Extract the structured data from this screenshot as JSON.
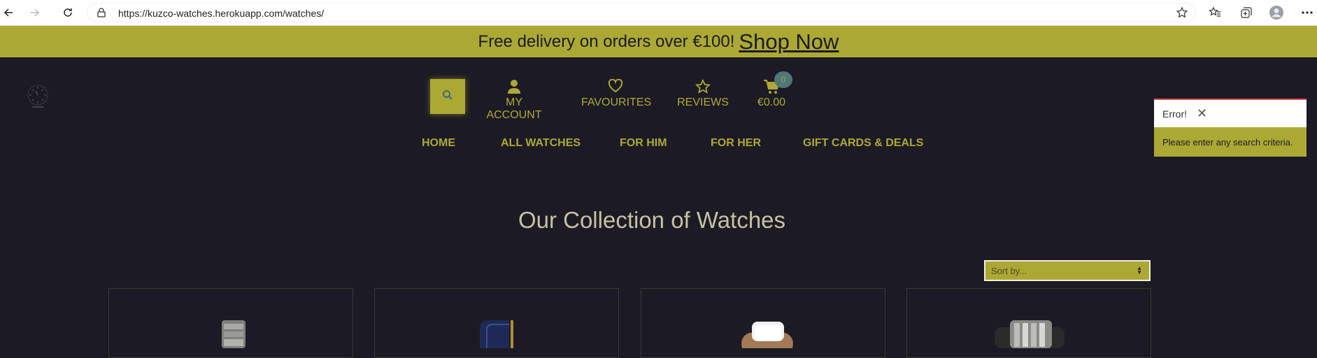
{
  "browser": {
    "url": "https://kuzco-watches.herokuapp.com/watches/",
    "icons": [
      "back-icon",
      "forward-icon",
      "reload-icon",
      "lock-icon",
      "favorite-add-icon",
      "favorites-icon",
      "collections-icon",
      "profile-icon",
      "more-icon"
    ]
  },
  "banner": {
    "text": "Free delivery on orders over €100!",
    "link": "Shop Now"
  },
  "header": {
    "my_account": "MY ACCOUNT",
    "favourites": "FAVOURITES",
    "reviews": "REVIEWS",
    "cart_total": "€0.00",
    "cart_count": "0"
  },
  "nav": {
    "home": "HOME",
    "all_watches": "ALL WATCHES",
    "for_him": "FOR HIM",
    "for_her": "FOR HER",
    "gift_cards": "GIFT CARDS & DEALS"
  },
  "toast": {
    "title": "Error!",
    "message": "Please enter any search criteria."
  },
  "main": {
    "heading": "Our Collection of Watches",
    "sort_placeholder": "Sort by..."
  },
  "colors": {
    "accent": "#aba934",
    "background": "#1c1a24",
    "badge": "#4f7678"
  }
}
